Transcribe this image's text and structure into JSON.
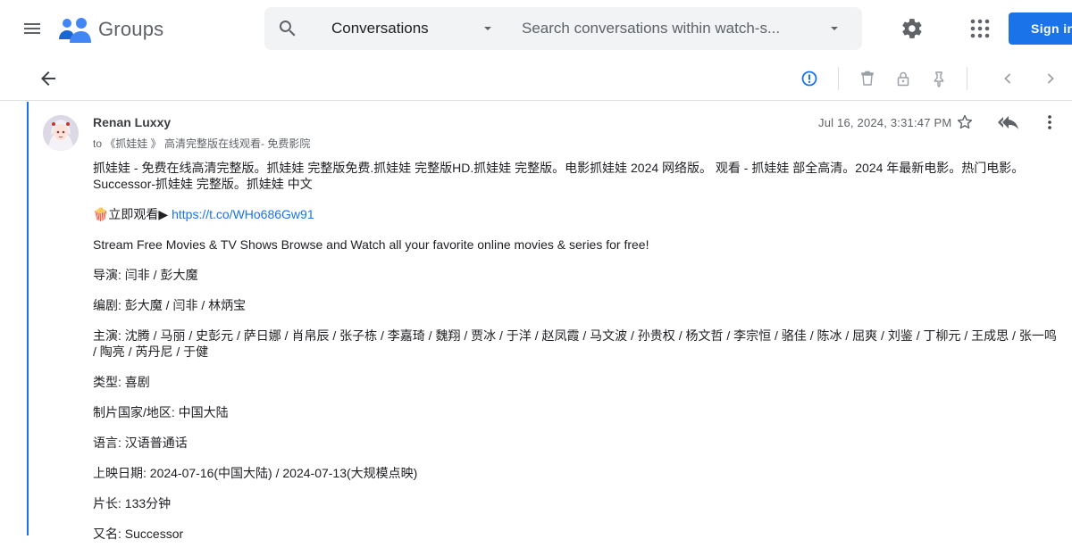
{
  "header": {
    "app_name": "Groups",
    "search_scope": "Conversations",
    "search_placeholder": "Search conversations within watch-s...",
    "sign_in_label": "Sign in"
  },
  "message": {
    "sender": "Renan Luxxy",
    "recipients": "to 《抓娃娃 》 高清完整版在线观看- 免费影院",
    "timestamp": "Jul 16, 2024, 3:31:47 PM",
    "body": {
      "intro": "抓娃娃 - 免费在线高清完整版。抓娃娃 完整版免费.抓娃娃 完整版HD.抓娃娃 完整版。电影抓娃娃 2024 网络版。 观看 - 抓娃娃 部全高清。2024 年最新电影。热门电影。Successor-抓娃娃 完整版。抓娃娃 中文",
      "watch_prefix": "🍿立即观看▶ ",
      "watch_link": "https://t.co/WHo686Gw91",
      "stream_text": "Stream Free Movies & TV Shows Browse and Watch all your favorite online movies & series for free!",
      "director": "导演: 闫非 / 彭大魔",
      "writer": "编剧: 彭大魔 / 闫非 / 林炳宝",
      "cast": "主演: 沈腾 / 马丽 / 史彭元 / 萨日娜 / 肖帛辰 / 张子栋 / 李嘉琦 / 魏翔 / 贾冰 / 于洋 / 赵凤霞 / 马文波 / 孙贵权 / 杨文哲 / 李宗恒 / 骆佳 / 陈冰 / 屈爽 / 刘鉴 / 丁柳元 / 王成思 / 张一鸣 / 陶亮 / 芮丹尼 / 于健",
      "genre": "类型: 喜剧",
      "country": "制片国家/地区: 中国大陆",
      "language": "语言: 汉语普通话",
      "release": "上映日期: 2024-07-16(中国大陆) / 2024-07-13(大规模点映)",
      "runtime": "片长: 133分钟",
      "aka": "又名: Successor"
    }
  },
  "colors": {
    "accent": "#1a73e8",
    "icon_gray": "#5f6368",
    "search_bg": "#f1f3f4"
  }
}
